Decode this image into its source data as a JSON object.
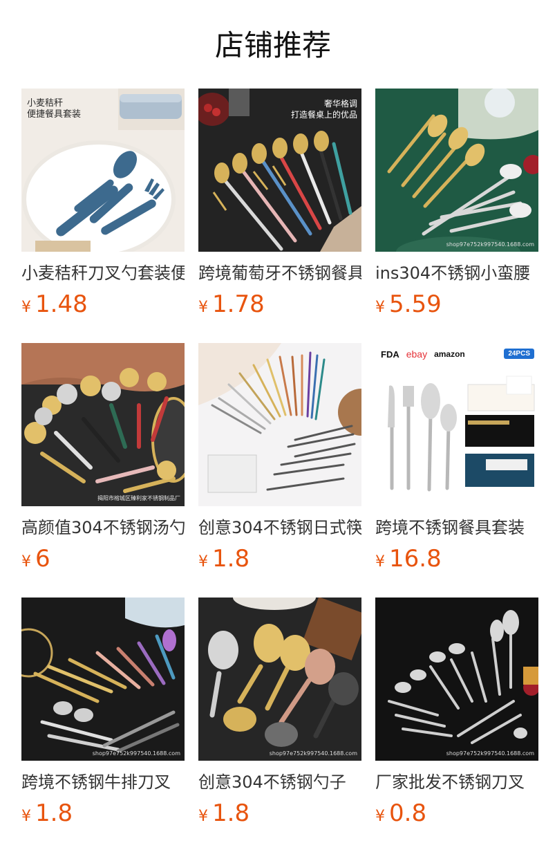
{
  "header": {
    "title": "店铺推荐"
  },
  "theme": {
    "price_color": "#e8540e",
    "title_color": "#111111",
    "text_color": "#333333"
  },
  "products": [
    {
      "name": "小麦秸秆刀叉勺套装便携餐具",
      "currency": "¥",
      "price": "1.48",
      "image": {
        "scene": "wheat-straw-cutlery",
        "overlay_lines": [
          "小麦秸秆",
          "便捷餐具套装"
        ],
        "watermark": ""
      }
    },
    {
      "name": "跨境葡萄牙不锈钢餐具",
      "currency": "¥",
      "price": "1.78",
      "image": {
        "scene": "portugal-cutlery-color",
        "overlay_lines": [
          "奢华格调",
          "打造餐桌上的优品"
        ],
        "watermark": ""
      }
    },
    {
      "name": "ins304不锈钢小蛮腰",
      "currency": "¥",
      "price": "5.59",
      "image": {
        "scene": "gold-silver-on-green",
        "overlay_lines": [],
        "watermark": "shop97e752k997540.1688.com"
      }
    },
    {
      "name": "高颜值304不锈钢汤勺",
      "currency": "¥",
      "price": "6",
      "image": {
        "scene": "ladles",
        "overlay_lines": [],
        "watermark": "揭阳市榕城区臻利家不锈钢制品厂"
      }
    },
    {
      "name": "创意304不锈钢日式筷",
      "currency": "¥",
      "price": "1.8",
      "image": {
        "scene": "chopsticks",
        "overlay_lines": [],
        "watermark": ""
      }
    },
    {
      "name": "跨境不锈钢餐具套装",
      "currency": "¥",
      "price": "16.8",
      "image": {
        "scene": "boxed-set",
        "overlay_lines": [],
        "logos": [
          "FDA",
          "ebay",
          "amazon"
        ],
        "badge": "24PCS",
        "watermark": ""
      }
    },
    {
      "name": "跨境不锈钢牛排刀叉",
      "currency": "¥",
      "price": "1.8",
      "image": {
        "scene": "ornate-rainbow",
        "overlay_lines": [],
        "watermark": "shop97e752k997540.1688.com"
      }
    },
    {
      "name": "创意304不锈钢勺子",
      "currency": "¥",
      "price": "1.8",
      "image": {
        "scene": "spork-colors",
        "overlay_lines": [],
        "watermark": "shop97e752k997540.1688.com"
      }
    },
    {
      "name": "厂家批发不锈钢刀叉",
      "currency": "¥",
      "price": "0.8",
      "image": {
        "scene": "silver-on-black",
        "overlay_lines": [],
        "watermark": "shop97e752k997540.1688.com"
      }
    }
  ]
}
